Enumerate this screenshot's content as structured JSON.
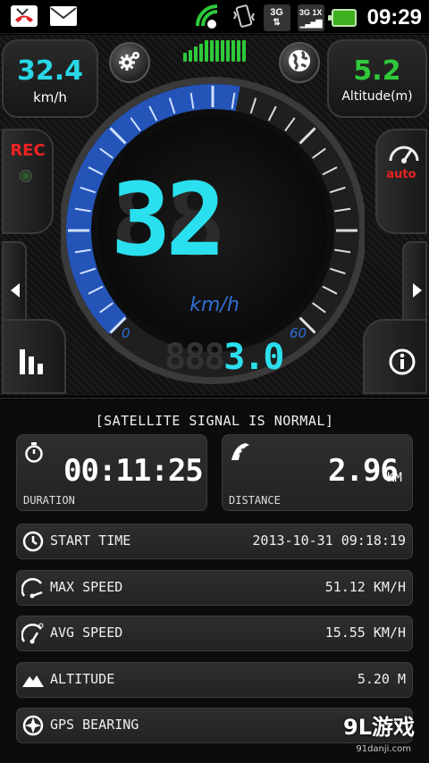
{
  "statusbar": {
    "icons": [
      "missed-call-icon",
      "mail-icon",
      "wifi-icon",
      "vibrate-icon",
      "3g-data-icon",
      "network-3g-1x-icon",
      "battery-icon"
    ],
    "network_3g": "3G",
    "network_1x": "1X",
    "time": "09:29"
  },
  "dashboard": {
    "speed": {
      "value": "32.4",
      "unit": "km/h"
    },
    "altitude": {
      "value": "5.2",
      "unit": "Altitude(m)"
    },
    "rec_label": "REC",
    "auto_label": "auto",
    "gauge": {
      "speed_digits": "32",
      "speed_unit": "km/h",
      "scale_min": "0",
      "scale_max": "60",
      "trip_value": "3.0",
      "speed_fraction_of_scale": 0.54
    },
    "colors": {
      "accent_cyan": "#2be0ee",
      "gauge_blue": "#2f6fd2",
      "altitude_green": "#2fc93a",
      "rec_red": "#e22222"
    }
  },
  "stats": {
    "signal_message": "[SATELLITE SIGNAL IS NORMAL]",
    "duration": {
      "value": "00:11:25",
      "label": "DURATION"
    },
    "distance": {
      "value": "2.96",
      "unit": "KM",
      "label": "DISTANCE"
    },
    "rows": [
      {
        "icon": "clock-icon",
        "label": "START TIME",
        "value": "2013-10-31 09:18:19"
      },
      {
        "icon": "max-speed-icon",
        "label": "MAX SPEED",
        "value": "51.12 KM/H"
      },
      {
        "icon": "avg-speed-icon",
        "label": "AVG SPEED",
        "value": "15.55 KM/H"
      },
      {
        "icon": "mountain-icon",
        "label": "ALTITUDE",
        "value": "5.20 M"
      },
      {
        "icon": "compass-icon",
        "label": "GPS BEARING",
        "value": ""
      }
    ]
  },
  "watermark": {
    "main": "9L游戏",
    "sub": "91danji.com"
  }
}
